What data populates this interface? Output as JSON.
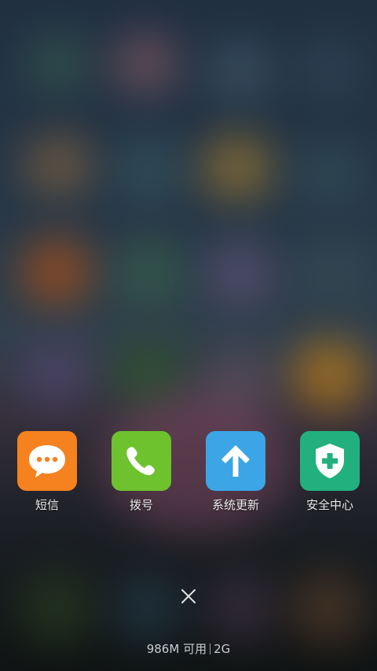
{
  "recents": {
    "apps": [
      {
        "label": "短信",
        "icon": "sms-chat-icon",
        "color": "#F5821F"
      },
      {
        "label": "拨号",
        "icon": "phone-handset-icon",
        "color": "#6DC22E"
      },
      {
        "label": "系统更新",
        "icon": "arrow-up-icon",
        "color": "#3BA5E6"
      },
      {
        "label": "安全中心",
        "icon": "security-shield-icon",
        "color": "#22B07E"
      }
    ]
  },
  "footer": {
    "memory_value": "986M",
    "memory_label": "可用",
    "memory_total": "2G"
  }
}
